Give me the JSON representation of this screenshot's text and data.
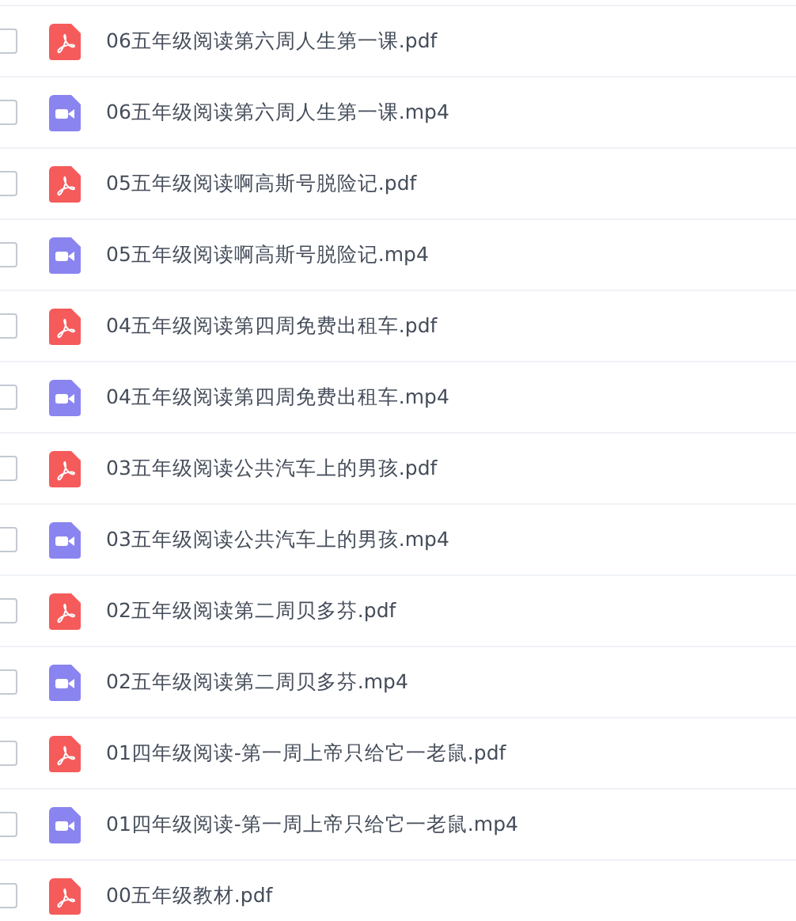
{
  "files": [
    {
      "name": "06五年级阅读第六周人生第一课.pdf",
      "kind": "pdf",
      "checked": false
    },
    {
      "name": "06五年级阅读第六周人生第一课.mp4",
      "kind": "video",
      "checked": false
    },
    {
      "name": "05五年级阅读啊高斯号脱险记.pdf",
      "kind": "pdf",
      "checked": false
    },
    {
      "name": "05五年级阅读啊高斯号脱险记.mp4",
      "kind": "video",
      "checked": false
    },
    {
      "name": "04五年级阅读第四周免费出租车.pdf",
      "kind": "pdf",
      "checked": false
    },
    {
      "name": "04五年级阅读第四周免费出租车.mp4",
      "kind": "video",
      "checked": false
    },
    {
      "name": "03五年级阅读公共汽车上的男孩.pdf",
      "kind": "pdf",
      "checked": false
    },
    {
      "name": "03五年级阅读公共汽车上的男孩.mp4",
      "kind": "video",
      "checked": false
    },
    {
      "name": "02五年级阅读第二周贝多芬.pdf",
      "kind": "pdf",
      "checked": false
    },
    {
      "name": "02五年级阅读第二周贝多芬.mp4",
      "kind": "video",
      "checked": false
    },
    {
      "name": "01四年级阅读-第一周上帝只给它一老鼠.pdf",
      "kind": "pdf",
      "checked": false
    },
    {
      "name": "01四年级阅读-第一周上帝只给它一老鼠.mp4",
      "kind": "video",
      "checked": false
    },
    {
      "name": "00五年级教材.pdf",
      "kind": "pdf",
      "checked": false
    }
  ]
}
